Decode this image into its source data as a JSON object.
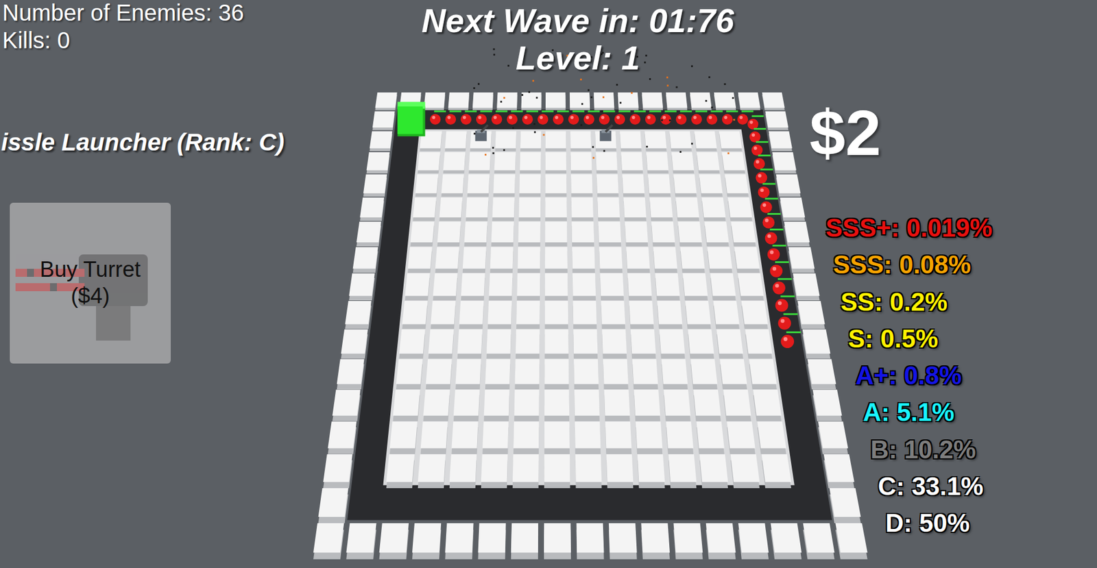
{
  "hud": {
    "enemies": "Number of Enemies: 36",
    "kills": "Kills: 0"
  },
  "wave": {
    "countdown": "Next Wave in: 01:76",
    "level": "Level: 1"
  },
  "selected_turret": {
    "name": "issle Launcher (Rank: C)"
  },
  "shop": {
    "label": "Buy Turret",
    "price": "($4)"
  },
  "money": "$2",
  "rarities": [
    {
      "label": "SSS+: 0.019%",
      "color": "#e8100f"
    },
    {
      "label": "SSS: 0.08%",
      "color": "#f5a300"
    },
    {
      "label": "SS: 0.2%",
      "color": "#fff200"
    },
    {
      "label": "S: 0.5%",
      "color": "#fff200"
    },
    {
      "label": "A+: 0.8%",
      "color": "#1414e6"
    },
    {
      "label": "A: 5.1%",
      "color": "#19f5ff"
    },
    {
      "label": "B: 10.2%",
      "color": "#7d7d7d"
    },
    {
      "label": "C: 33.1%",
      "color": "#ffffff"
    },
    {
      "label": "D: 50%",
      "color": "#ffffff"
    }
  ]
}
